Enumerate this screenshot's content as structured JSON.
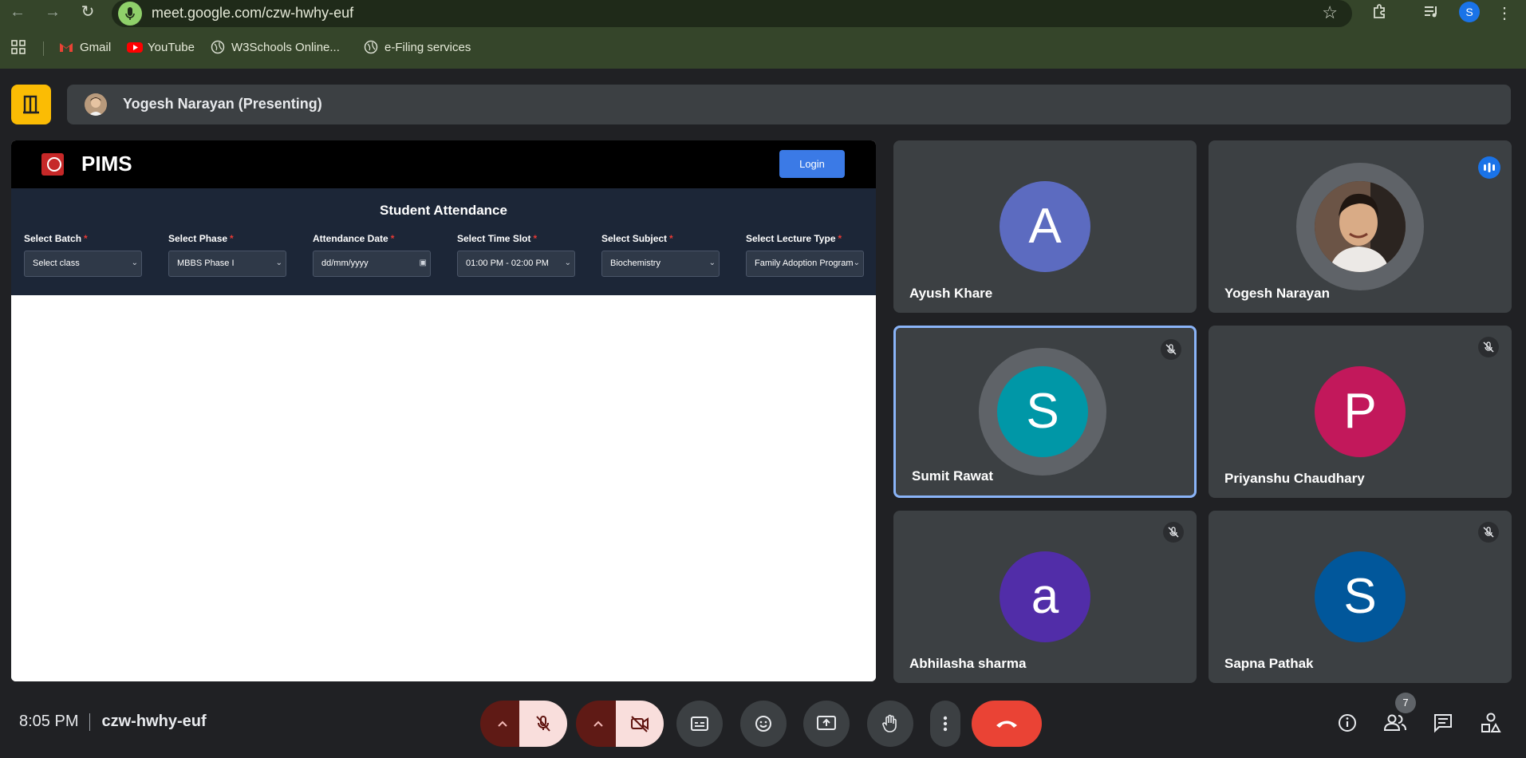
{
  "browser": {
    "url": "meet.google.com/czw-hwhy-euf",
    "profile_initial": "S",
    "bookmarks": [
      {
        "label": "Gmail"
      },
      {
        "label": "YouTube"
      },
      {
        "label": "W3Schools Online..."
      },
      {
        "label": "e-Filing services"
      }
    ]
  },
  "meet": {
    "presenting_label": "Yogesh Narayan (Presenting)",
    "time": "8:05 PM",
    "meeting_code": "czw-hwhy-euf",
    "participant_count": "7"
  },
  "shared_screen": {
    "app_name": "PIMS",
    "login_label": "Login",
    "form_title": "Student Attendance",
    "fields": [
      {
        "label": "Select Batch",
        "value": "Select class"
      },
      {
        "label": "Select Phase",
        "value": "MBBS Phase I"
      },
      {
        "label": "Attendance Date",
        "value": "dd/mm/yyyy"
      },
      {
        "label": "Select Time Slot",
        "value": "01:00 PM - 02:00 PM"
      },
      {
        "label": "Select Subject",
        "value": "Biochemistry"
      },
      {
        "label": "Select Lecture Type",
        "value": "Family Adoption Program"
      }
    ],
    "required_marker": "*"
  },
  "participants": [
    {
      "name": "Ayush Khare",
      "initial": "A",
      "color": "#5c6bc0",
      "muted": false
    },
    {
      "name": "Yogesh Narayan",
      "initial": "",
      "color": "#8a6a55",
      "muted": false,
      "speaking": true
    },
    {
      "name": "Sumit Rawat",
      "initial": "S",
      "color": "#0097a7",
      "muted": true,
      "active": true
    },
    {
      "name": "Priyanshu Chaudhary",
      "initial": "P",
      "color": "#c2185b",
      "muted": true
    },
    {
      "name": "Abhilasha sharma",
      "initial": "a",
      "color": "#512da8",
      "muted": true
    },
    {
      "name": "Sapna Pathak",
      "initial": "S",
      "color": "#01579b",
      "muted": true
    }
  ],
  "colors": {
    "accent": "#8ab4f8",
    "end_call": "#ea4335",
    "exit_button": "#fbbc04"
  }
}
